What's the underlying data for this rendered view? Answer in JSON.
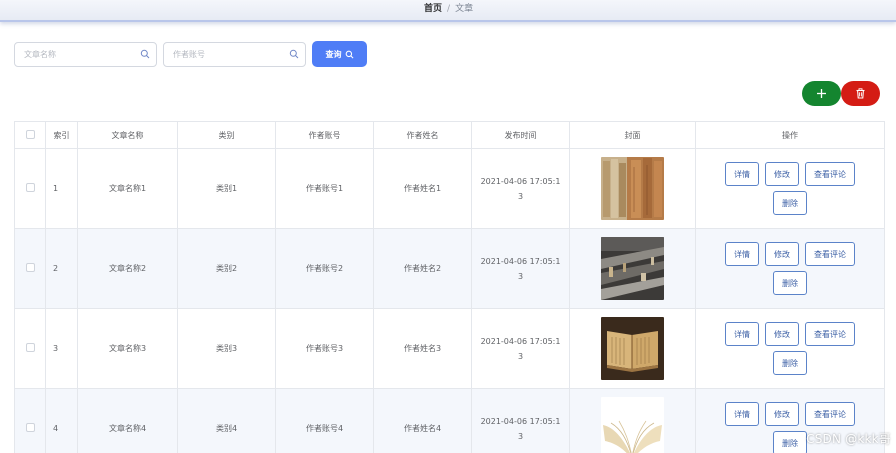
{
  "breadcrumb": {
    "home": "首页",
    "separator": "/",
    "current": "文章"
  },
  "search": {
    "title_placeholder": "文章名称",
    "account_placeholder": "作者账号",
    "query_label": "查询"
  },
  "colors": {
    "primary": "#4f7df6",
    "add": "#14852f",
    "delete": "#d41c14",
    "outline": "#5b83c9"
  },
  "icons": {
    "search": "search-icon",
    "add": "plus-icon",
    "delete": "trash-icon"
  },
  "table": {
    "headers": [
      "索引",
      "文章名称",
      "类别",
      "作者账号",
      "作者姓名",
      "发布时间",
      "封面",
      "操作"
    ],
    "rows": [
      {
        "index": "1",
        "title": "文章名称1",
        "category": "类别1",
        "account": "作者账号1",
        "author": "作者姓名1",
        "time_line1": "2021-04-06 17:05:1",
        "time_line2": "3",
        "cover": "old-book-spines"
      },
      {
        "index": "2",
        "title": "文章名称2",
        "category": "类别2",
        "account": "作者账号2",
        "author": "作者姓名2",
        "time_line1": "2021-04-06 17:05:1",
        "time_line2": "3",
        "cover": "library-shelves"
      },
      {
        "index": "3",
        "title": "文章名称3",
        "category": "类别3",
        "account": "作者账号3",
        "author": "作者姓名3",
        "time_line1": "2021-04-06 17:05:1",
        "time_line2": "3",
        "cover": "open-ancient-book"
      },
      {
        "index": "4",
        "title": "文章名称4",
        "category": "类别4",
        "account": "作者账号4",
        "author": "作者姓名4",
        "time_line1": "2021-04-06 17:05:1",
        "time_line2": "3",
        "cover": "open-book-pages"
      }
    ],
    "actions": {
      "detail": "详情",
      "edit": "修改",
      "comments": "查看评论",
      "delete": "删除"
    }
  },
  "watermark": "CSDN @kkk哥"
}
